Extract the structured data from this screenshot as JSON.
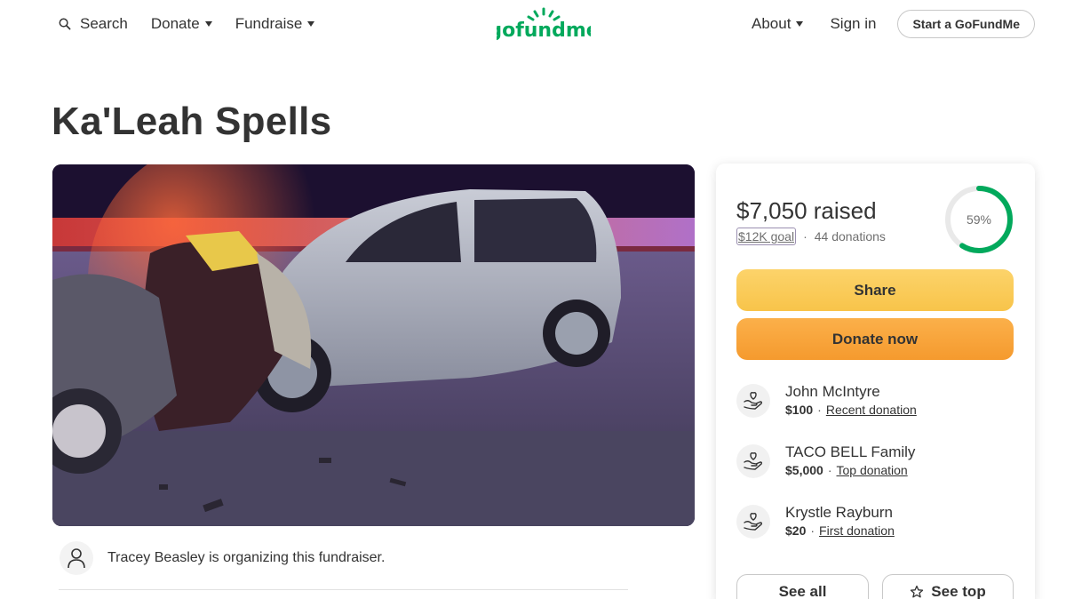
{
  "header": {
    "search_label": "Search",
    "donate_label": "Donate",
    "fundraise_label": "Fundraise",
    "logo_text": "gofundme",
    "about_label": "About",
    "signin_label": "Sign in",
    "start_label": "Start a GoFundMe"
  },
  "campaign": {
    "title": "Ka'Leah Spells",
    "organizer_text": "Tracey Beasley is organizing this fundraiser."
  },
  "summary": {
    "raised_text": "$7,050 raised",
    "goal_text": "$12K goal",
    "separator": "·",
    "donations_count_text": "44 donations",
    "progress_percent": 59,
    "progress_label": "59%",
    "share_label": "Share",
    "donate_now_label": "Donate now"
  },
  "donations": [
    {
      "name": "John McIntyre",
      "amount": "$100",
      "type": "Recent donation"
    },
    {
      "name": "TACO BELL Family",
      "amount": "$5,000",
      "type": "Top donation"
    },
    {
      "name": "Krystle Rayburn",
      "amount": "$20",
      "type": "First donation"
    }
  ],
  "buttons": {
    "see_all_label": "See all",
    "see_top_label": "See top"
  },
  "colors": {
    "brand_green": "#02a95c",
    "share_yellow": "#f8c44a",
    "donate_orange": "#f59a2e",
    "text_dark": "#333333"
  },
  "icons": {
    "search": "search-icon",
    "caret": "caret-down-icon",
    "organizer": "user-icon",
    "donation": "donation-hand-heart-icon",
    "star": "star-icon"
  }
}
